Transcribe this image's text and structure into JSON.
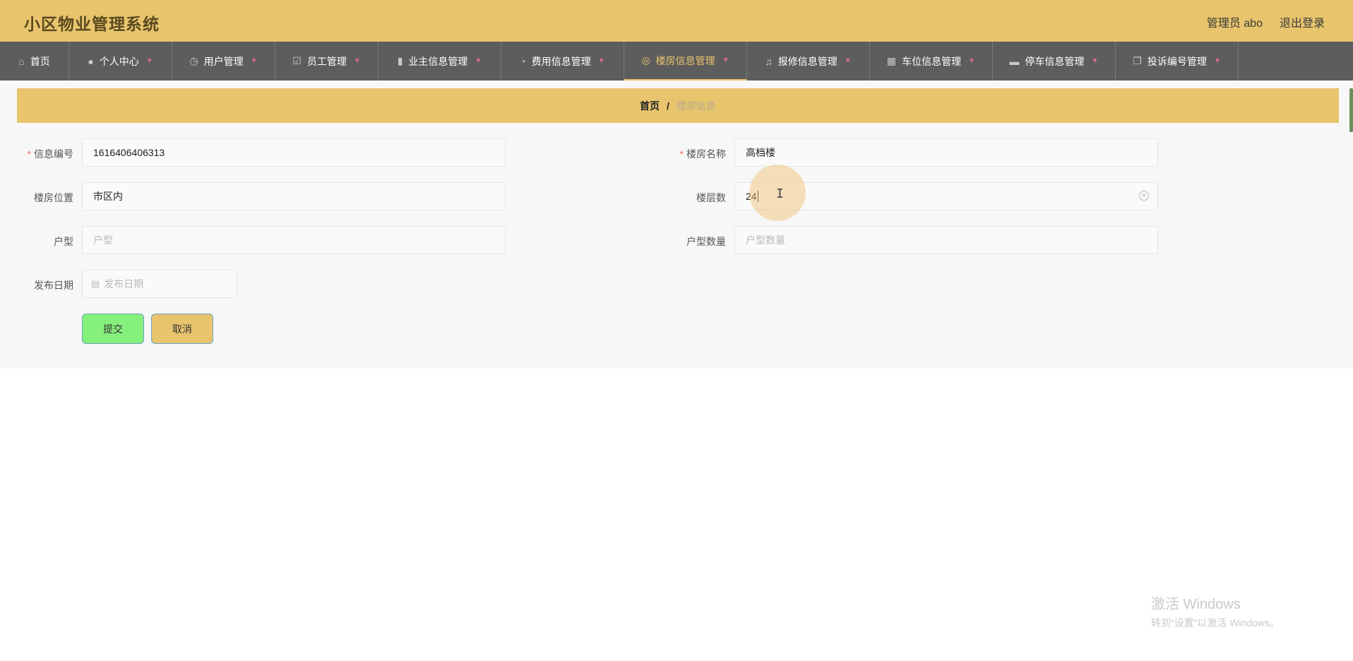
{
  "header": {
    "title": "小区物业管理系统",
    "user_label": "管理员 abo",
    "logout_label": "退出登录"
  },
  "nav": {
    "items": [
      {
        "label": "首页",
        "icon": "home-icon"
      },
      {
        "label": "个人中心",
        "icon": "user-icon"
      },
      {
        "label": "用户管理",
        "icon": "clock-icon"
      },
      {
        "label": "员工管理",
        "icon": "check-icon"
      },
      {
        "label": "业主信息管理",
        "icon": "book-icon"
      },
      {
        "label": "费用信息管理",
        "icon": "gauge-icon"
      },
      {
        "label": "楼房信息管理",
        "icon": "compass-icon"
      },
      {
        "label": "报修信息管理",
        "icon": "bell-off-icon"
      },
      {
        "label": "车位信息管理",
        "icon": "grid-icon"
      },
      {
        "label": "停车信息管理",
        "icon": "monitor-icon"
      },
      {
        "label": "投诉编号管理",
        "icon": "copy-icon"
      }
    ],
    "active_index": 6,
    "active_color": "#e8c46d"
  },
  "breadcrumb": {
    "home": "首页",
    "separator": "/",
    "current": "楼房信息"
  },
  "form": {
    "info_no": {
      "label": "信息编号",
      "value": "1616406406313",
      "required": true
    },
    "building_name": {
      "label": "楼房名称",
      "value": "高档楼",
      "required": true
    },
    "location": {
      "label": "楼房位置",
      "value": "市区内"
    },
    "floors": {
      "label": "楼层数",
      "value": "24"
    },
    "unit_type": {
      "label": "户型",
      "placeholder": "户型"
    },
    "unit_count": {
      "label": "户型数量",
      "placeholder": "户型数量"
    },
    "publish_date": {
      "label": "发布日期",
      "placeholder": "发布日期"
    }
  },
  "buttons": {
    "submit": "提交",
    "cancel": "取消"
  },
  "colors": {
    "header_bg": "#e8c46d",
    "nav_bg": "#5e5d5d",
    "submit_bg": "#86f07c",
    "cancel_bg": "#e8c46d"
  },
  "watermark": {
    "title": "激活 Windows",
    "subtitle": "转到“设置”以激活 Windows。"
  }
}
